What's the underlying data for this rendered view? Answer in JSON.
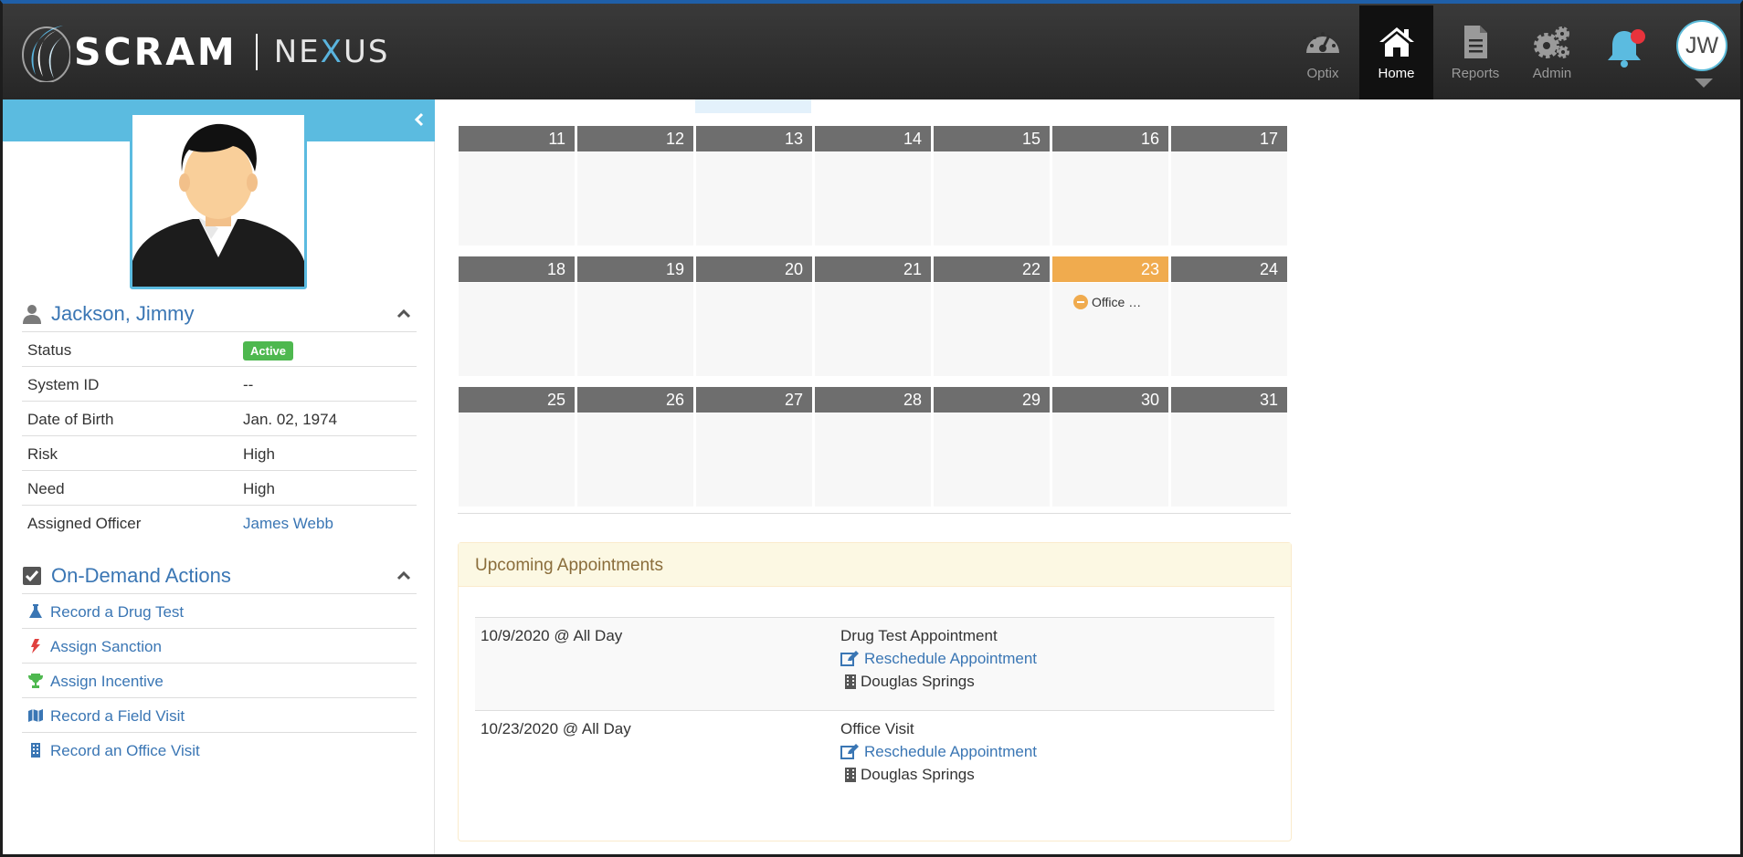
{
  "header": {
    "logo_scram": "SCRAM",
    "logo_nexus_prefix": "NE",
    "logo_nexus_x": "X",
    "logo_nexus_suffix": "US",
    "nav": [
      {
        "label": "Optix",
        "icon": "dashboard-gauge-icon"
      },
      {
        "label": "Home",
        "icon": "home-icon",
        "active": true
      },
      {
        "label": "Reports",
        "icon": "document-icon"
      },
      {
        "label": "Admin",
        "icon": "gears-icon"
      }
    ],
    "notifications_icon": "bell-icon",
    "user_initials": "JW",
    "colors": {
      "bar": "#2d2d2d",
      "active_nav": "#111111",
      "accent": "#5bbbe0",
      "notification_dot": "#e8333c"
    }
  },
  "client": {
    "name": "Jackson, Jimmy",
    "fields": [
      {
        "label": "Status",
        "value": "Active",
        "type": "badge"
      },
      {
        "label": "System ID",
        "value": "--"
      },
      {
        "label": "Date of Birth",
        "value": "Jan. 02, 1974"
      },
      {
        "label": "Risk",
        "value": "High"
      },
      {
        "label": "Need",
        "value": "High"
      },
      {
        "label": "Assigned Officer",
        "value": "James Webb",
        "type": "link"
      }
    ]
  },
  "actions": {
    "title": "On-Demand Actions",
    "items": [
      {
        "label": "Record a Drug Test",
        "icon": "flask-icon"
      },
      {
        "label": "Assign Sanction",
        "icon": "lightning-bolt-icon"
      },
      {
        "label": "Assign Incentive",
        "icon": "trophy-icon"
      },
      {
        "label": "Record a Field Visit",
        "icon": "map-icon"
      },
      {
        "label": "Record an Office Visit",
        "icon": "building-icon"
      }
    ]
  },
  "calendar": {
    "weeks": [
      [
        "11",
        "12",
        "13",
        "14",
        "15",
        "16",
        "17"
      ],
      [
        "18",
        "19",
        "20",
        "21",
        "22",
        "23",
        "24"
      ],
      [
        "25",
        "26",
        "27",
        "28",
        "29",
        "30",
        "31"
      ]
    ],
    "today": "23",
    "event": {
      "day": "23",
      "label": "Office …",
      "icon": "minus-circle-icon"
    },
    "colors": {
      "day_head": "#6e6e6e",
      "today": "#f0ab4e",
      "cell": "#f7f7f7"
    }
  },
  "appointments": {
    "title": "Upcoming Appointments",
    "items": [
      {
        "date": "10/9/2020",
        "at": "@",
        "time": "All Day",
        "type": "Drug Test Appointment",
        "action": "Reschedule Appointment",
        "location": "Douglas Springs"
      },
      {
        "date": "10/23/2020",
        "at": "@",
        "time": "All Day",
        "type": "Office Visit",
        "action": "Reschedule Appointment",
        "location": "Douglas Springs"
      }
    ]
  }
}
